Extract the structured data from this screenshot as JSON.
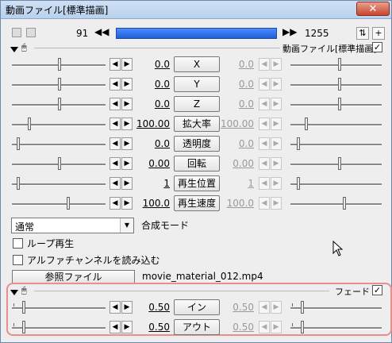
{
  "window": {
    "title": "動画ファイル[標準描画]",
    "close_label": "✕"
  },
  "timeline": {
    "start": "91",
    "end": "1255"
  },
  "section": {
    "title": "動画ファイル[標準描画]",
    "checked": "✓"
  },
  "params": [
    {
      "label": "X",
      "value": "0.0",
      "end_value": "0.0"
    },
    {
      "label": "Y",
      "value": "0.0",
      "end_value": "0.0"
    },
    {
      "label": "Z",
      "value": "0.0",
      "end_value": "0.0"
    },
    {
      "label": "拡大率",
      "value": "100.00",
      "end_value": "100.00"
    },
    {
      "label": "透明度",
      "value": "0.0",
      "end_value": "0.0"
    },
    {
      "label": "回転",
      "value": "0.00",
      "end_value": "0.00"
    },
    {
      "label": "再生位置",
      "value": "1",
      "end_value": "1"
    },
    {
      "label": "再生速度",
      "value": "100.0",
      "end_value": "100.0"
    }
  ],
  "blend": {
    "selected": "通常",
    "label": "合成モード"
  },
  "options": [
    {
      "label": "ループ再生",
      "checked": false
    },
    {
      "label": "アルファチャンネルを読み込む",
      "checked": false
    }
  ],
  "reference": {
    "button_label": "参照ファイル",
    "file_name": "movie_material_012.mp4"
  },
  "fade": {
    "title": "フェード",
    "checked": "✓",
    "params": [
      {
        "label": "イン",
        "value": "0.50",
        "end_value": "0.50"
      },
      {
        "label": "アウト",
        "value": "0.50",
        "end_value": "0.50"
      }
    ]
  }
}
